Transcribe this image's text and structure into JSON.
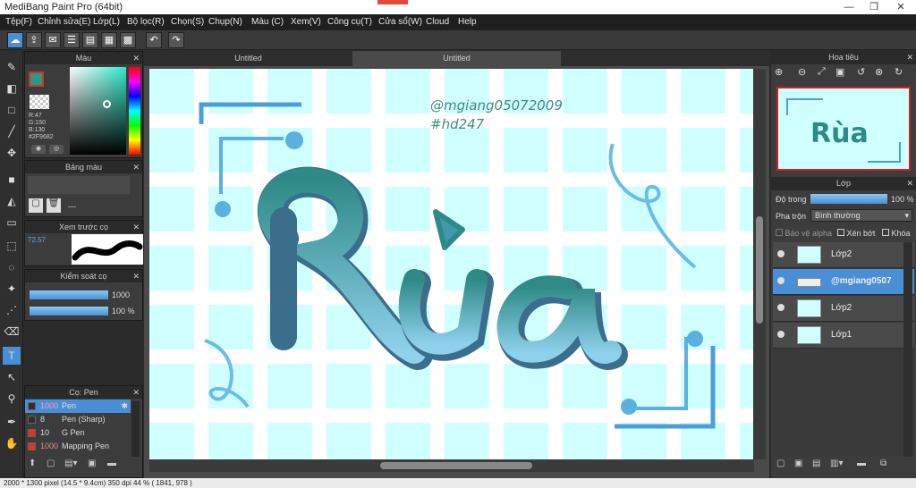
{
  "app": {
    "title": "MediBang Paint Pro (64bit)"
  },
  "menu": [
    "Tệp(F)",
    "Chỉnh sửa(E)",
    "Lớp(L)",
    "Bộ lọc(R)",
    "Chọn(S)",
    "Chụp(N)",
    "Màu (C)",
    "Xem(V)",
    "Công cụ(T)",
    "Cửa sổ(W)",
    "Cloud",
    "Help"
  ],
  "panels": {
    "color": {
      "title": "Màu",
      "r": "R:47",
      "g": "G:150",
      "b": "B:130",
      "hex": "#2F9682",
      "fg": "#2f9682"
    },
    "palette": {
      "title": "Bảng màu",
      "dashes": "---"
    },
    "preview": {
      "title": "Xem trước cọ",
      "size": "72.57"
    },
    "control": {
      "title": "Kiểm soát cọ",
      "size": "1000",
      "opacity": "100 %"
    },
    "brushes": {
      "title": "Cọ: Pen",
      "items": [
        {
          "num": "1000",
          "label": "Pen",
          "color": "#2f2f2f"
        },
        {
          "num": "8",
          "label": "Pen (Sharp)",
          "color": "#2f2f2f"
        },
        {
          "num": "10",
          "label": "G Pen",
          "color": "#e03030"
        },
        {
          "num": "1000",
          "label": "Mapping Pen",
          "color": "#e03030"
        }
      ]
    }
  },
  "tabs": [
    "Untitled",
    "Untitled"
  ],
  "art": {
    "watermark": "@mgiang05072009",
    "tag": "#hd247",
    "word": "Rùa"
  },
  "navigator": {
    "title": "Hoa tiêu"
  },
  "layers": {
    "title": "Lớp",
    "opacity_label": "Độ trong",
    "opacity_value": "100 %",
    "blend_label": "Pha trộn",
    "blend_value": "Bình thường",
    "protect_alpha": "Bảo vệ alpha",
    "clip": "Xén bớt",
    "lock": "Khóa",
    "items": [
      "Lớp2",
      "@mgiang0507",
      "Lớp2",
      "Lớp1"
    ]
  },
  "status": {
    "text": "2000 * 1300 pixel   (14.5 * 9.4cm)   350 dpi   44 %   ( 1841, 978 )"
  },
  "colors": {
    "accent": "#4a8fd6",
    "teal": "#2f9682",
    "bg": "#cfffff"
  }
}
